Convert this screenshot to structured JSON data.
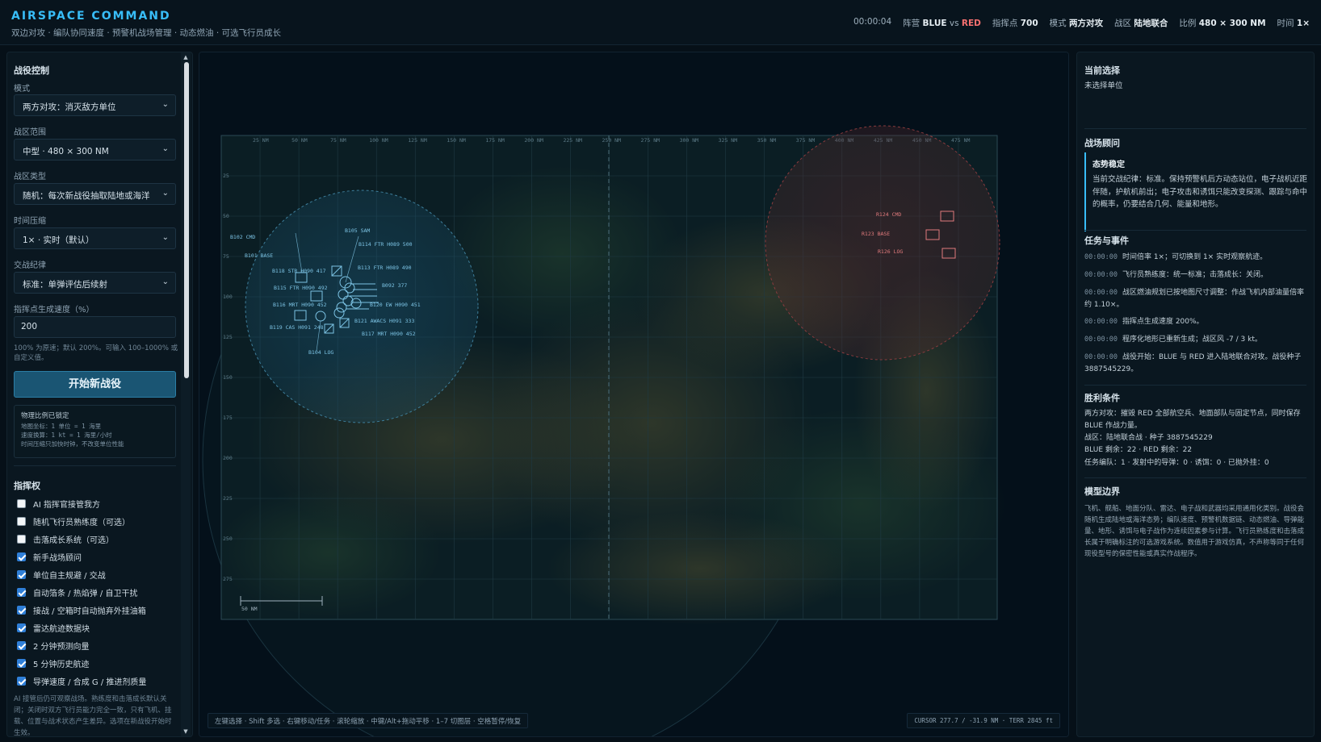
{
  "header": {
    "title": "AIRSPACE COMMAND",
    "subtitle": "双边对攻 · 编队协同速度 · 预警机战场管理 · 动态燃油 · 可选飞行员成长",
    "clock": "00:00:04",
    "side_label": "阵营",
    "side_blue": "BLUE",
    "side_vs": "vs",
    "side_red": "RED",
    "cp_label": "指挥点",
    "cp_value": "700",
    "mode_label": "模式",
    "mode_value": "两方对攻",
    "zone_label": "战区",
    "zone_value": "陆地联合",
    "scale_label": "比例",
    "scale_value": "480 × 300 NM",
    "time_label": "时间",
    "time_value": "1×"
  },
  "left": {
    "section_title": "战役控制",
    "mode_label": "模式",
    "mode_value": "两方对攻：消灭敌方单位",
    "range_label": "战区范围",
    "range_value": "中型 · 480 × 300 NM",
    "type_label": "战区类型",
    "type_value": "随机：每次新战役抽取陆地或海洋",
    "timecomp_label": "时间压缩",
    "timecomp_value": "1× · 实时（默认）",
    "roe_label": "交战纪律",
    "roe_value": "标准：单弹评估后续射",
    "cp_rate_label": "指挥点生成速度（%）",
    "cp_rate_value": "200",
    "cp_rate_hint": "100% 为原速；默认 200%。可输入 100–1000% 或自定义值。",
    "start_button": "开始新战役",
    "lock_title": "物理比例已锁定",
    "lock_lines": [
      "地图坐标：1 单位 = 1 海里",
      "速度换算：1 kt = 1 海里/小时",
      "时间压缩只加快时钟，不改变单位性能"
    ],
    "command_title": "指挥权",
    "checks": [
      {
        "label": "AI 指挥官接管我方",
        "checked": false
      },
      {
        "label": "随机飞行员熟练度（可选）",
        "checked": false
      },
      {
        "label": "击落成长系统（可选）",
        "checked": false
      },
      {
        "label": "新手战场顾问",
        "checked": true
      },
      {
        "label": "单位自主规避 / 交战",
        "checked": true
      },
      {
        "label": "自动箔条 / 热焰弹 / 自卫干扰",
        "checked": true
      },
      {
        "label": "接战 / 空箱时自动抛弃外挂油箱",
        "checked": true
      },
      {
        "label": "雷达航迹数据块",
        "checked": true
      },
      {
        "label": "2 分钟预测向量",
        "checked": true
      },
      {
        "label": "5 分钟历史航迹",
        "checked": true
      },
      {
        "label": "导弹速度 / 合成 G / 推进剂质量",
        "checked": true
      }
    ],
    "bottom_note": "AI 接管后仍可观察战场。熟练度和击落成长默认关闭；关闭时双方飞行员能力完全一致，只有飞机、挂载、位置与战术状态产生差异。选项在新战役开始时生效。"
  },
  "map": {
    "ruler_ticks": [
      "25 NM",
      "50 NM",
      "75 NM",
      "100 NM",
      "125 NM",
      "150 NM",
      "175 NM",
      "200 NM",
      "225 NM",
      "250 NM",
      "275 NM",
      "300 NM",
      "325 NM",
      "350 NM",
      "375 NM",
      "400 NM",
      "425 NM",
      "450 NM",
      "475 NM"
    ],
    "side_ticks": [
      "25",
      "50",
      "75",
      "100",
      "125",
      "150",
      "175",
      "200",
      "225",
      "250",
      "275"
    ],
    "blue_units": [
      "B102 CMD",
      "B101 BASE",
      "B105 SAM",
      "B114 FTR H089 500",
      "B113 FTR H089 490",
      "B118 STR H090 417",
      "B092 377",
      "B115 FTR H090 492",
      "B116 MRT H090 452",
      "B120 EW H090 451",
      "B121 AWACS H091 333",
      "B119 CAS H091 248",
      "B117 MRT H090 452",
      "B104 LOG"
    ],
    "red_units": [
      "R124 CMD",
      "R123 BASE",
      "R126 LOG"
    ],
    "scale_bar_label": "50 NM",
    "hint": "左键选择 · Shift 多选 · 右键移动/任务 · 滚轮缩放 · 中键/Alt+拖动平移 · 1–7 切图层 · 空格暂停/恢复",
    "cursor": "CURSOR 277.7 / -31.9 NM · TERR 2845 ft",
    "colors": {
      "blue": "#38bdf8",
      "red": "#f87171",
      "terrain": "#2c3a26"
    }
  },
  "right": {
    "selection_title": "当前选择",
    "selection_value": "未选择单位",
    "advisor_title": "战场顾问",
    "advisor_card_title": "态势稳定",
    "advisor_card_body": "当前交战纪律：标准。保持预警机后方动态站位，电子战机近距伴随，护航机前出；电子攻击和诱饵只能改变探测、跟踪与命中的概率，仍要结合几何、能量和地形。",
    "events_title": "任务与事件",
    "events": [
      {
        "t": "00:00:00",
        "msg": "时间倍率 1×；可切换到 1× 实时观察航迹。"
      },
      {
        "t": "00:00:00",
        "msg": "飞行员熟练度：统一标准；击落成长：关闭。"
      },
      {
        "t": "00:00:00",
        "msg": "战区燃油规划已按地图尺寸调整：作战飞机内部油量倍率约 1.10×。"
      },
      {
        "t": "00:00:00",
        "msg": "指挥点生成速度 200%。"
      },
      {
        "t": "00:00:00",
        "msg": "程序化地形已重新生成；战区风 -7 / 3 kt。"
      },
      {
        "t": "00:00:00",
        "msg": "战役开始：BLUE 与 RED 进入陆地联合对攻。战役种子 3887545229。"
      }
    ],
    "victory_title": "胜利条件",
    "victory_lines": [
      "两方对攻：摧毁 RED 全部航空兵、地面部队与固定节点，同时保存 BLUE 作战力量。",
      "战区：陆地联合战 · 种子 3887545229",
      "BLUE 剩余：22 · RED 剩余：22",
      "任务编队：1 · 发射中的导弹：0 · 诱饵：0 · 已抛外挂：0"
    ],
    "model_title": "模型边界",
    "model_body": "飞机、舰船、地面分队、雷达、电子战和武器均采用通用化类别。战役会随机生成陆地或海洋态势；编队速度、预警机数据链、动态燃油、导弹能量、地形、诱饵与电子战作为连续因素参与计算。飞行员熟练度和击落成长属于明确标注的可选游戏系统。数值用于游戏仿真，不声称等同于任何现役型号的保密性能或真实作战程序。"
  }
}
